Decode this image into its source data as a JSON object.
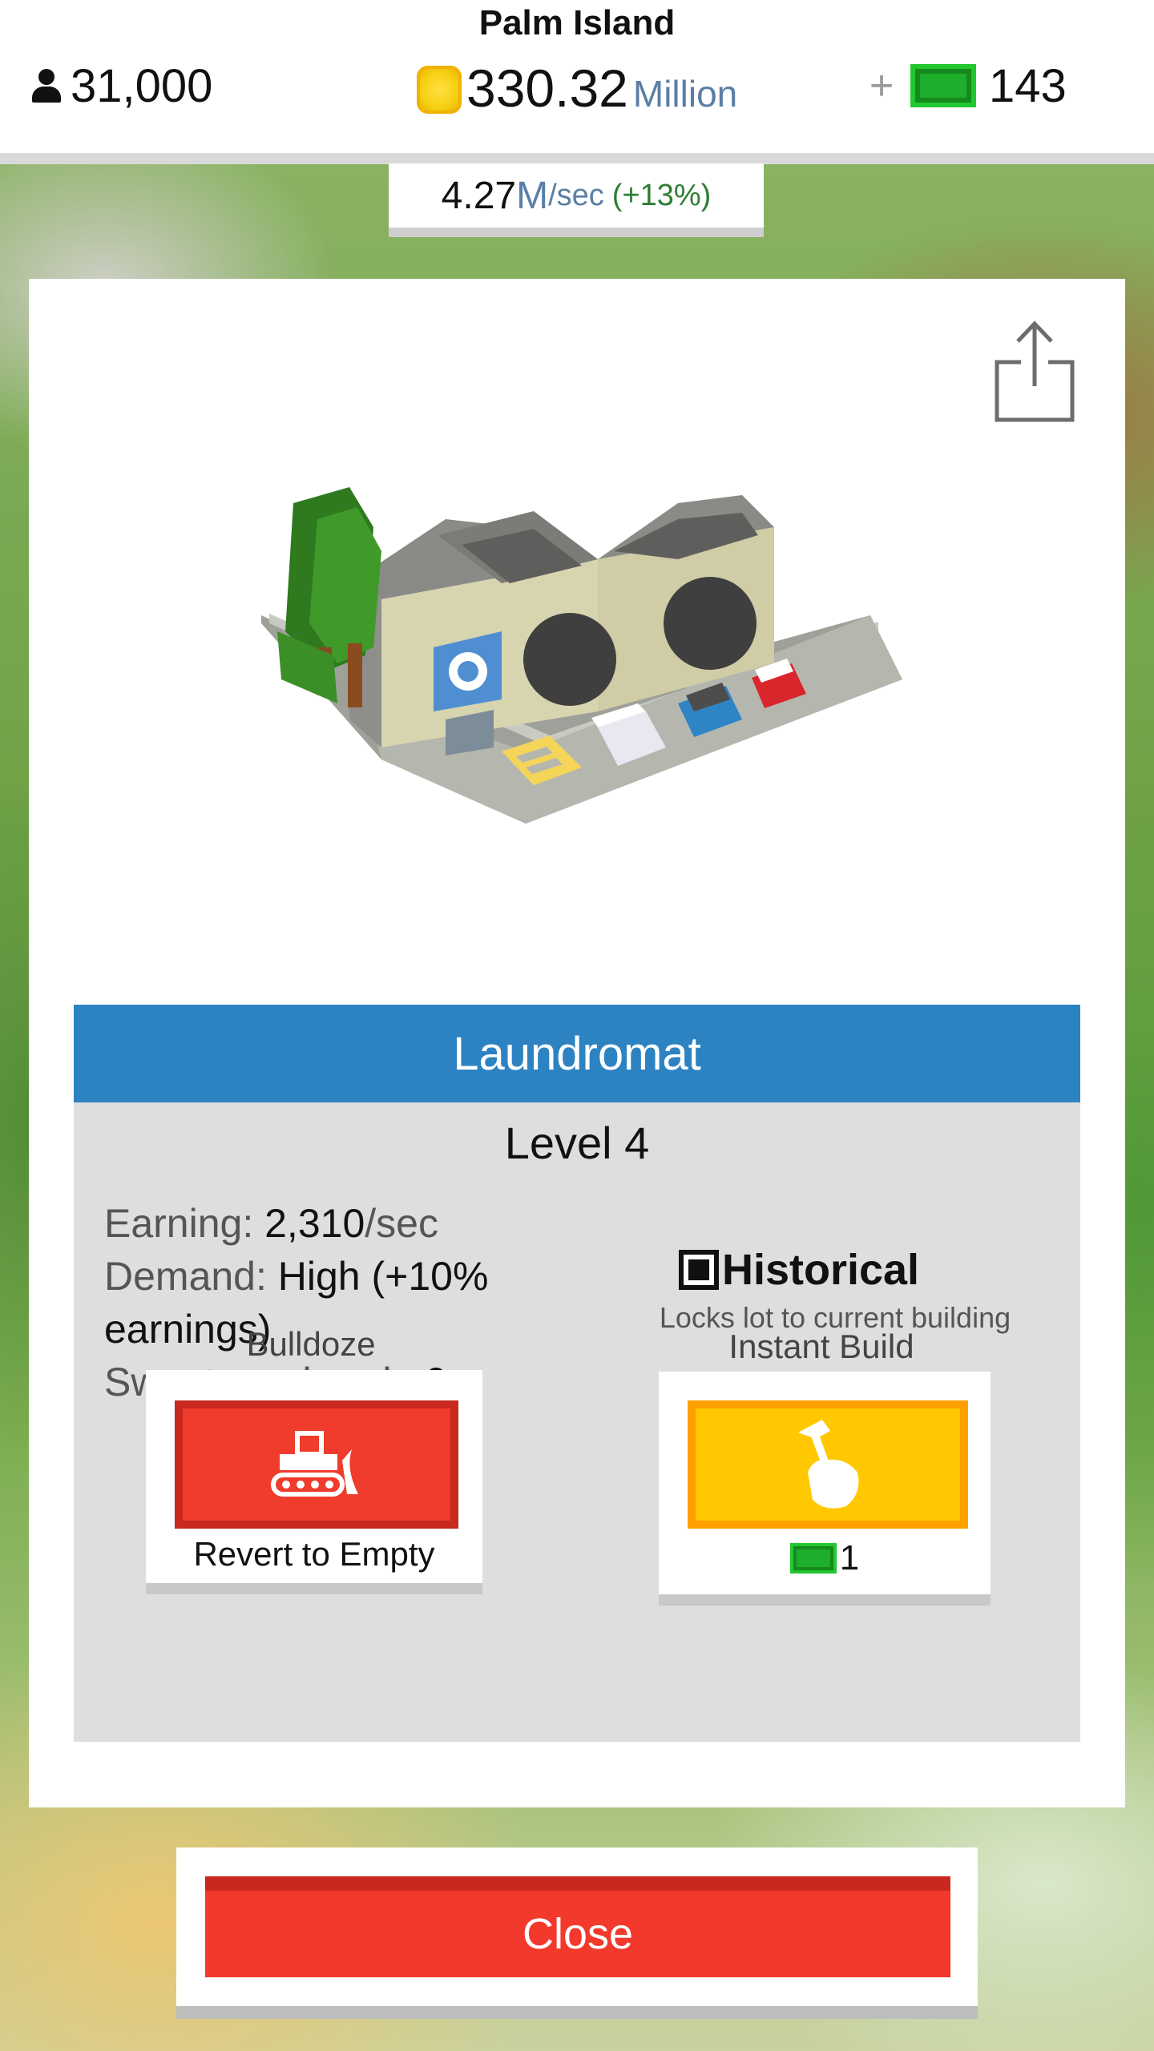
{
  "header": {
    "island_name": "Palm Island",
    "population": "31,000",
    "money_value": "330.32",
    "money_unit": "Million",
    "plus": "+",
    "gems": "143",
    "rate_value": "4.27",
    "rate_unit": "M",
    "rate_per": "/sec",
    "rate_bonus": "(+13%)"
  },
  "panel": {
    "building_name": "Laundromat",
    "level": "Level 4",
    "stats": {
      "earning_label": "Earning: ",
      "earning_value": "2,310",
      "earning_unit": "/sec",
      "demand_label": "Demand: ",
      "demand_value": "High (+10% earnings)",
      "sweaters_label": "Sweaters shrunk: ",
      "sweaters_value": "0"
    },
    "historical": {
      "label": "Historical",
      "description": "Locks lot to current building"
    },
    "bulldoze": {
      "label": "Bulldoze",
      "button_text": "Revert to Empty"
    },
    "instant_build": {
      "label": "Instant Build",
      "cost": "1"
    }
  },
  "close_label": "Close",
  "icons": {
    "population": "person-icon",
    "money": "coin-icon",
    "gems": "gem-icon",
    "share": "share-icon",
    "bulldoze": "bulldozer-icon",
    "instant_build": "hammer-hand-icon",
    "historical": "checkbox-icon"
  },
  "colors": {
    "title_bar": "#2d83c2",
    "bulldoze": "#ef3c2c",
    "instant_build": "#ffc800",
    "close": "#f2392c",
    "gem": "#1fae2b",
    "coin": "#f7cf12"
  }
}
